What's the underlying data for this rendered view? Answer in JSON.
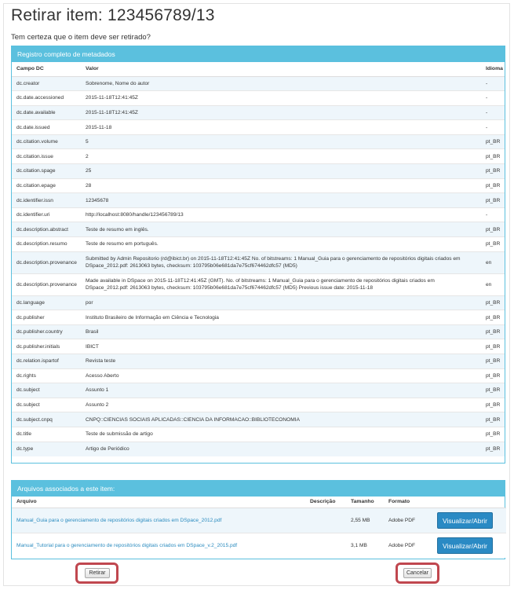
{
  "page": {
    "title": "Retirar item: 123456789/13",
    "question": "Tem certeza que o item deve ser retirado?"
  },
  "metadata": {
    "heading": "Registro completo de metadados",
    "columns": [
      "Campo DC",
      "Valor",
      "Idioma"
    ],
    "rows": [
      {
        "field": "dc.creator",
        "value": "Sobrenome, Nome do autor",
        "lang": "-"
      },
      {
        "field": "dc.date.accessioned",
        "value": "2015-11-18T12:41:45Z",
        "lang": "-"
      },
      {
        "field": "dc.date.available",
        "value": "2015-11-18T12:41:45Z",
        "lang": "-"
      },
      {
        "field": "dc.date.issued",
        "value": "2015-11-18",
        "lang": "-"
      },
      {
        "field": "dc.citation.volume",
        "value": "5",
        "lang": "pt_BR"
      },
      {
        "field": "dc.citation.issue",
        "value": "2",
        "lang": "pt_BR"
      },
      {
        "field": "dc.citation.spage",
        "value": "25",
        "lang": "pt_BR"
      },
      {
        "field": "dc.citation.epage",
        "value": "28",
        "lang": "pt_BR"
      },
      {
        "field": "dc.identifier.issn",
        "value": "12345678",
        "lang": "pt_BR"
      },
      {
        "field": "dc.identifier.uri",
        "value": "http://localhost:8080/handle/123456789/13",
        "lang": "-"
      },
      {
        "field": "dc.description.abstract",
        "value": "Teste de resumo em inglês.",
        "lang": "pt_BR"
      },
      {
        "field": "dc.description.resumo",
        "value": "Teste de resumo em português.",
        "lang": "pt_BR"
      },
      {
        "field": "dc.description.provenance",
        "value": "Submitted by Admin Repositorio (rd@ibict.br) on 2015-11-18T12:41:45Z No. of bitstreams: 1 Manual_Guia para o gerenciamento de repositórios digitais criados em DSpace_2012.pdf: 2613063 bytes, checksum: 103795b06e681da7e75cf674462dfc57 (MD5)",
        "lang": "en"
      },
      {
        "field": "dc.description.provenance",
        "value": "Made available in DSpace on 2015-11-18T12:41:45Z (GMT). No. of bitstreams: 1 Manual_Guia para o gerenciamento de repositórios digitais criados em DSpace_2012.pdf: 2613063 bytes, checksum: 103795b06e681da7e75cf674462dfc57 (MD5) Previous issue date: 2015-11-18",
        "lang": "en"
      },
      {
        "field": "dc.language",
        "value": "por",
        "lang": "pt_BR"
      },
      {
        "field": "dc.publisher",
        "value": "Instituto Brasileiro de Informação em Ciência e Tecnologia",
        "lang": "pt_BR"
      },
      {
        "field": "dc.publisher.country",
        "value": "Brasil",
        "lang": "pt_BR"
      },
      {
        "field": "dc.publisher.initials",
        "value": "IBICT",
        "lang": "pt_BR"
      },
      {
        "field": "dc.relation.ispartof",
        "value": "Revista teste",
        "lang": "pt_BR"
      },
      {
        "field": "dc.rights",
        "value": "Acesso Aberto",
        "lang": "pt_BR"
      },
      {
        "field": "dc.subject",
        "value": "Assunto 1",
        "lang": "pt_BR"
      },
      {
        "field": "dc.subject",
        "value": "Assunto 2",
        "lang": "pt_BR"
      },
      {
        "field": "dc.subject.cnpq",
        "value": "CNPQ::CIENCIAS SOCIAIS APLICADAS::CIENCIA DA INFORMACAO::BIBLIOTECONOMIA",
        "lang": "pt_BR"
      },
      {
        "field": "dc.title",
        "value": "Teste de submissão de artigo",
        "lang": "pt_BR"
      },
      {
        "field": "dc.type",
        "value": "Artigo de Periódico",
        "lang": "pt_BR"
      }
    ]
  },
  "files": {
    "heading": "Arquivos associados a este item:",
    "columns": [
      "Arquivo",
      "Descrição",
      "Tamanho",
      "Formato",
      ""
    ],
    "rows": [
      {
        "name": "Manual_Guia para o gerenciamento de repositórios digitais criados em DSpace_2012.pdf",
        "description": "",
        "size": "2,55 MB",
        "format": "Adobe PDF",
        "action": "Visualizar/Abrir"
      },
      {
        "name": "Manual_Tutorial para o gerenciamento de repositórios digitais criados em DSpace_v.2_2015.pdf",
        "description": "",
        "size": "3,1 MB",
        "format": "Adobe PDF",
        "action": "Visualizar/Abrir"
      }
    ]
  },
  "actions": {
    "withdraw_label": "Retirar",
    "cancel_label": "Cancelar"
  },
  "colors": {
    "panel_header": "#5bc0de",
    "link": "#2a8bbf",
    "primary_button": "#2a8ac4",
    "highlight": "#c0474f"
  }
}
